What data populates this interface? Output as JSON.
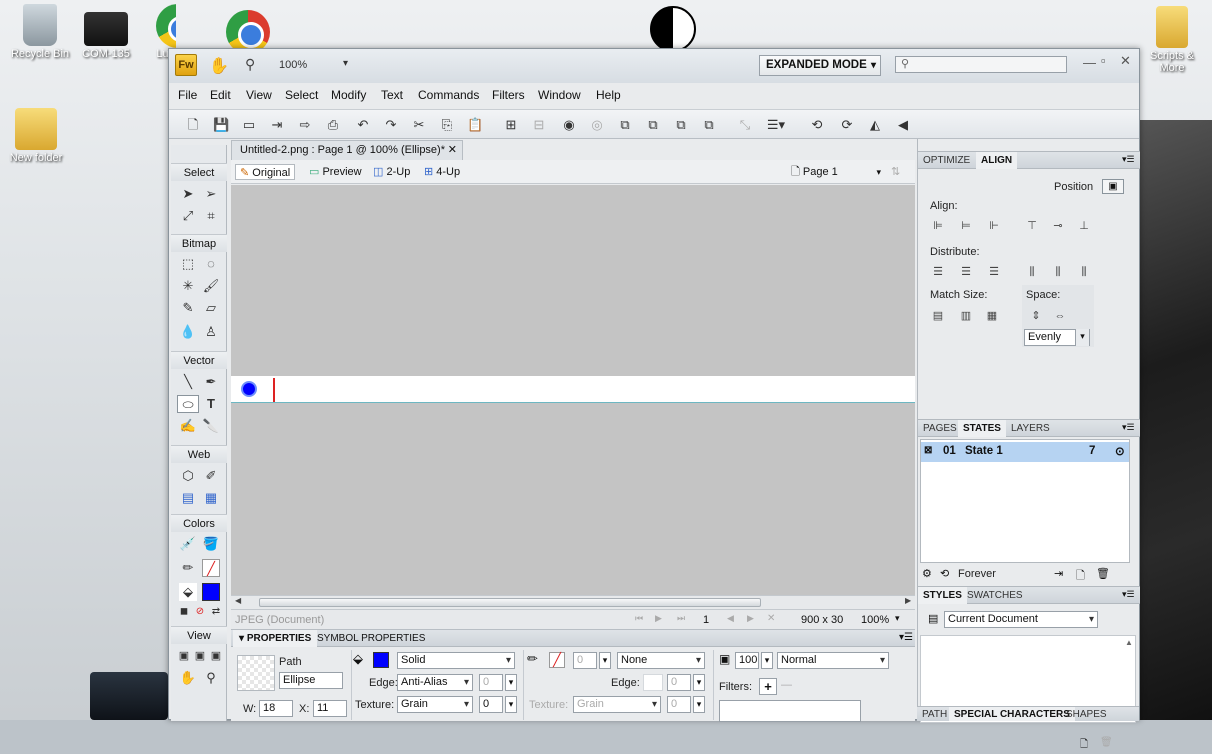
{
  "desktop": {
    "icons": [
      {
        "label": "Recycle Bin"
      },
      {
        "label": "COM-135"
      },
      {
        "label": "Luf"
      },
      {
        "label": "New folder"
      },
      {
        "label": "Scripts & More"
      }
    ]
  },
  "app": {
    "logo": "Fw",
    "zoom": "100%",
    "mode": "EXPANDED MODE",
    "search_placeholder": "",
    "menu": [
      "File",
      "Edit",
      "View",
      "Select",
      "Modify",
      "Text",
      "Commands",
      "Filters",
      "Window",
      "Help"
    ]
  },
  "document": {
    "tab_title": "Untitled-2.png : Page 1 @ 100% (Ellipse)*",
    "views": [
      "Original",
      "Preview",
      "2-Up",
      "4-Up"
    ],
    "page": "Page 1"
  },
  "tools": {
    "sections": [
      "Select",
      "Bitmap",
      "Vector",
      "Web",
      "Colors",
      "View"
    ]
  },
  "status": {
    "format": "JPEG (Document)",
    "frame": "1",
    "size": "900 x 30",
    "zoom": "100%"
  },
  "properties": {
    "tabs": [
      "PROPERTIES",
      "SYMBOL PROPERTIES"
    ],
    "object_type": "Path",
    "object_name": "Ellipse",
    "w_label": "W:",
    "w_value": "18",
    "x_label": "X:",
    "x_value": "11",
    "fill_type": "Solid",
    "edge_label": "Edge:",
    "edge_value": "Anti-Alias",
    "edge_amount": "0",
    "texture_label": "Texture:",
    "texture_value": "Grain",
    "texture_amount": "0",
    "stroke_size": "0",
    "stroke_type": "None",
    "stroke_edge_label": "Edge:",
    "stroke_edge_value": "0",
    "stroke_texture_label": "Texture:",
    "stroke_texture_value": "Grain",
    "stroke_texture_amount": "0",
    "opacity": "100",
    "blend": "Normal",
    "filters_label": "Filters:"
  },
  "colors": {
    "fill": "#0000ff",
    "stroke_none": "#ff0000",
    "selection": "#b6d3f2"
  },
  "align_panel": {
    "tabs": [
      "OPTIMIZE",
      "ALIGN"
    ],
    "position_label": "Position",
    "align_label": "Align:",
    "distribute_label": "Distribute:",
    "match_size_label": "Match Size:",
    "space_label": "Space:",
    "space_value": "Evenly"
  },
  "states_panel": {
    "tabs": [
      "PAGES",
      "STATES",
      "LAYERS"
    ],
    "rows": [
      {
        "num": "01",
        "name": "State 1",
        "delay": "7"
      }
    ],
    "loop": "Forever"
  },
  "styles_panel": {
    "tabs": [
      "STYLES",
      "SWATCHES"
    ],
    "library": "Current Document"
  },
  "bottom_tabs": [
    "PATH",
    "SPECIAL CHARACTERS",
    "SHAPES"
  ]
}
